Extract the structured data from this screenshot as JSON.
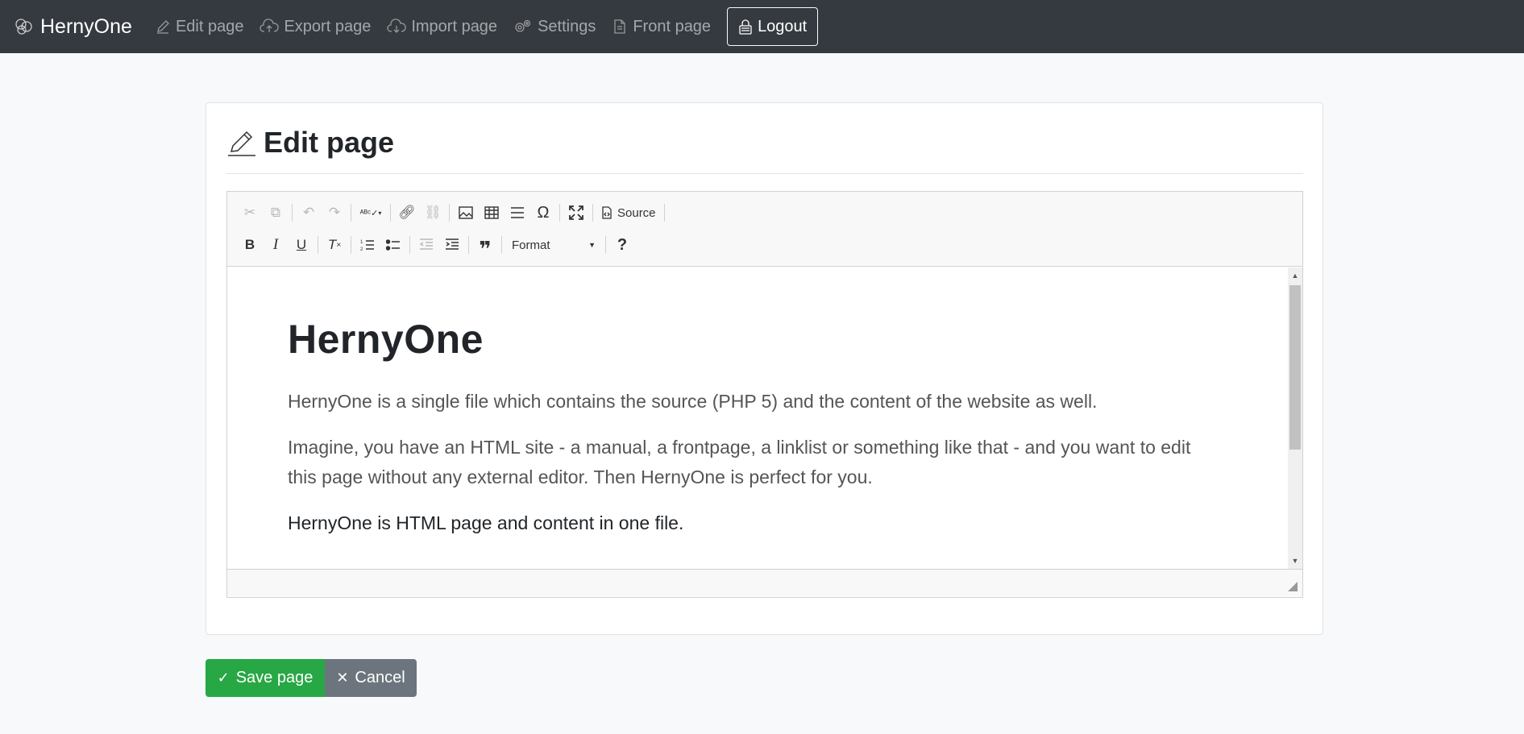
{
  "navbar": {
    "brand": "HernyOne",
    "items": [
      {
        "label": "Edit page",
        "icon": "pencil-icon"
      },
      {
        "label": "Export page",
        "icon": "cloud-upload-icon"
      },
      {
        "label": "Import page",
        "icon": "cloud-download-icon"
      },
      {
        "label": "Settings",
        "icon": "gears-icon"
      },
      {
        "label": "Front page",
        "icon": "document-icon"
      }
    ],
    "logout_label": "Logout"
  },
  "card": {
    "title": "Edit page"
  },
  "editor": {
    "toolbar": {
      "source_label": "Source",
      "format_label": "Format"
    },
    "content": {
      "heading": "HernyOne",
      "paragraphs": [
        "HernyOne is a single file which contains the source (PHP 5) and the content of the website as well.",
        "Imagine, you have an HTML site - a manual, a frontpage, a linklist or something like that - and you want to edit this page without any external editor. Then HernyOne is perfect for you.",
        "HernyOne is HTML page and content in one file."
      ]
    }
  },
  "actions": {
    "save_label": "Save page",
    "cancel_label": "Cancel"
  },
  "colors": {
    "navbar_bg": "#343a40",
    "save_bg": "#28a745",
    "cancel_bg": "#6c757d"
  }
}
